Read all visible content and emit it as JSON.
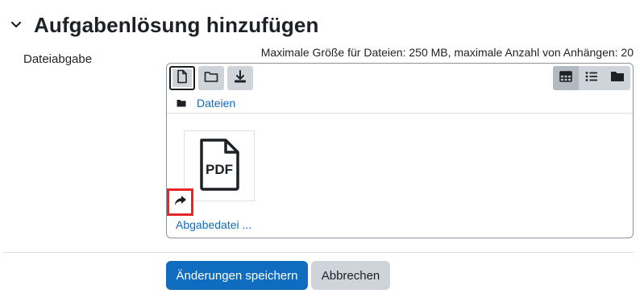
{
  "section": {
    "title": "Aufgabenlösung hinzufügen",
    "toggle_icon": "chevron-down-icon"
  },
  "field": {
    "label": "Dateiabgabe",
    "limits_text": "Maximale Größe für Dateien: 250 MB, maximale Anzahl von Anhängen: 20"
  },
  "filemanager": {
    "toolbar": [
      {
        "icon": "add-file-icon",
        "active": true
      },
      {
        "icon": "create-folder-icon",
        "active": false
      },
      {
        "icon": "download-icon",
        "active": false
      }
    ],
    "views": [
      {
        "icon": "grid-view-icon",
        "active": true
      },
      {
        "icon": "list-view-icon",
        "active": false
      },
      {
        "icon": "tree-view-icon",
        "active": false
      }
    ],
    "path": {
      "icon": "folder-icon",
      "label": "Dateien"
    },
    "files": [
      {
        "name": "Abgabedatei ...",
        "type_icon": "pdf-file-icon",
        "badge_icon": "alias-arrow-icon"
      }
    ]
  },
  "buttons": {
    "save_label": "Änderungen speichern",
    "cancel_label": "Abbrechen"
  },
  "colors": {
    "accent": "#0f6cbf",
    "highlight": "#e5262a",
    "button_gray": "#ced4da",
    "text": "#1d2125"
  }
}
